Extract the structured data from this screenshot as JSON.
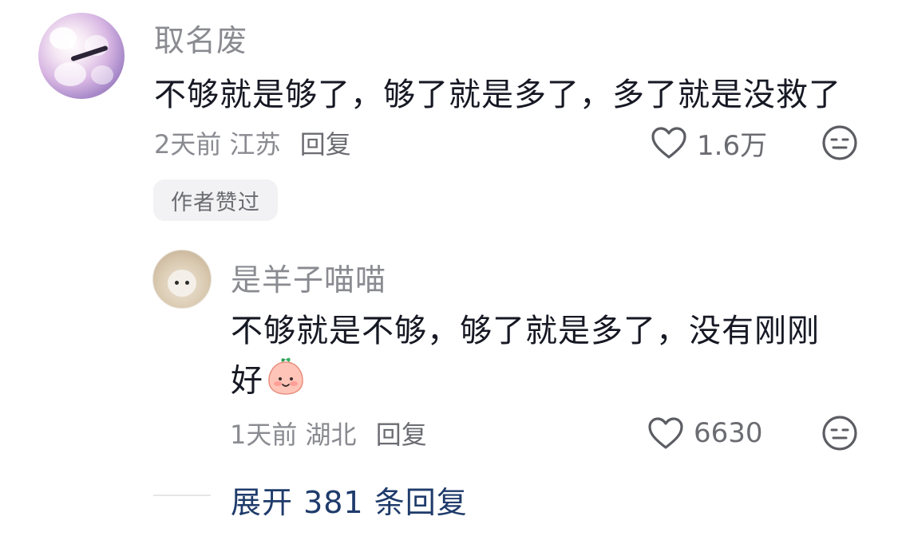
{
  "comment": {
    "username": "取名废",
    "text": "不够就是够了，够了就是多了，多了就是没救了",
    "time": "2天前",
    "location": "江苏",
    "reply_label": "回复",
    "like_count": "1.6万",
    "author_liked_badge": "作者赞过"
  },
  "reply": {
    "username": "是羊子喵喵",
    "text": "不够就是不够，够了就是多了，没有刚刚好",
    "emoji": "peach-bun-emoji",
    "time": "1天前",
    "location": "湖北",
    "reply_label": "回复",
    "like_count": "6630"
  },
  "expand_replies": "展开 381 条回复",
  "colors": {
    "primary_text": "#161823",
    "secondary_text": "#8a8b91",
    "link_blue": "#1f3b6b",
    "badge_bg": "#f2f2f4"
  },
  "icons": [
    "heart-outline-icon",
    "dislike-face-icon"
  ]
}
